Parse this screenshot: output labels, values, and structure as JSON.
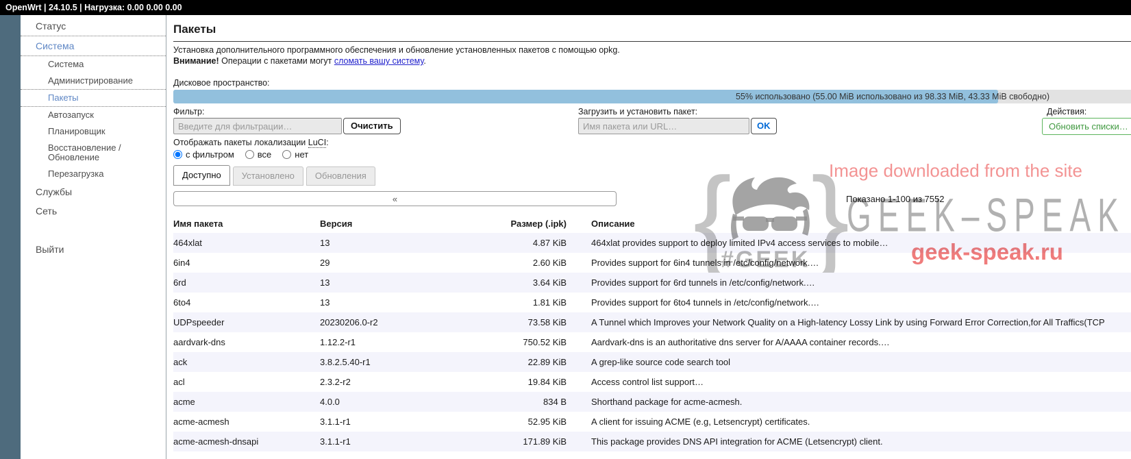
{
  "topbar": {
    "title": "OpenWrt | 24.10.5 | Нагрузка: 0.00 0.00 0.00"
  },
  "sidebar": {
    "items": [
      {
        "key": "status",
        "label": "Статус",
        "level": "top"
      },
      {
        "key": "system",
        "label": "Система",
        "level": "top",
        "active": true,
        "dot_top": true,
        "dot_bottom": true
      },
      {
        "key": "system-sub",
        "label": "Система",
        "level": "sub"
      },
      {
        "key": "administration",
        "label": "Администрирование",
        "level": "sub"
      },
      {
        "key": "packages",
        "label": "Пакеты",
        "level": "sub",
        "active": true,
        "dot_top": true,
        "dot_bottom": true
      },
      {
        "key": "startup",
        "label": "Автозапуск",
        "level": "sub"
      },
      {
        "key": "scheduler",
        "label": "Планировщик",
        "level": "sub"
      },
      {
        "key": "backup-restore",
        "label": "Восстановление / Обновление",
        "level": "sub"
      },
      {
        "key": "reboot",
        "label": "Перезагрузка",
        "level": "sub"
      },
      {
        "key": "services",
        "label": "Службы",
        "level": "top"
      },
      {
        "key": "network",
        "label": "Сеть",
        "level": "top"
      },
      {
        "key": "logout",
        "label": "Выйти",
        "level": "top",
        "logout": true
      }
    ]
  },
  "page": {
    "title": "Пакеты",
    "intro": "Установка дополнительного программного обеспечения и обновление установленных пакетов с помощью opkg.",
    "warning_bold": "Внимание!",
    "warning_mid": " Операции с пакетами могут ",
    "warning_link": "сломать вашу систему",
    "warning_suffix": "."
  },
  "disk": {
    "label": "Дисковое пространство:",
    "percent_used": 55,
    "usage_text": "55% использовано (55.00 MiB использовано из 98.33 MiB, 43.33 MiB свободно)"
  },
  "filter": {
    "label": "Фильтр:",
    "placeholder": "Введите для фильтрации…",
    "value": "",
    "clear_label": "Очистить"
  },
  "upload": {
    "label": "Загрузить и установить пакет:",
    "placeholder": "Имя пакета или URL…",
    "value": "",
    "ok_label": "OK"
  },
  "actions": {
    "label": "Действия:",
    "update_label": "Обновить списки…"
  },
  "display_options": {
    "label_prefix": "Отображать пакеты локализации ",
    "abbr": "LuCI",
    "label_suffix": ":",
    "options": [
      {
        "label": "с фильтром",
        "checked": true
      },
      {
        "label": "все",
        "checked": false
      },
      {
        "label": "нет",
        "checked": false
      }
    ]
  },
  "tabs": [
    {
      "key": "available",
      "label": "Доступно",
      "active": true
    },
    {
      "key": "installed",
      "label": "Установлено",
      "active": false
    },
    {
      "key": "updates",
      "label": "Обновления",
      "active": false
    }
  ],
  "pagination": {
    "prev_label": "«",
    "info": "Показано 1-100 из 7552"
  },
  "table": {
    "columns": [
      "Имя пакета",
      "Версия",
      "Размер (.ipk)",
      "Описание"
    ],
    "rows": [
      {
        "name": "464xlat",
        "version": "13",
        "size": "4.87 KiB",
        "desc": "464xlat provides support to deploy limited IPv4 access services to mobile…"
      },
      {
        "name": "6in4",
        "version": "29",
        "size": "2.60 KiB",
        "desc": "Provides support for 6in4 tunnels in /etc/config/network.…"
      },
      {
        "name": "6rd",
        "version": "13",
        "size": "3.64 KiB",
        "desc": "Provides support for 6rd tunnels in /etc/config/network.…"
      },
      {
        "name": "6to4",
        "version": "13",
        "size": "1.81 KiB",
        "desc": "Provides support for 6to4 tunnels in /etc/config/network.…"
      },
      {
        "name": "UDPspeeder",
        "version": "20230206.0-r2",
        "size": "73.58 KiB",
        "desc": "A Tunnel which Improves your Network Quality on a High-latency Lossy Link by using Forward Error Correction,for All Traffics(TCP"
      },
      {
        "name": "aardvark-dns",
        "version": "1.12.2-r1",
        "size": "750.52 KiB",
        "desc": "Aardvark-dns is an authoritative dns server for A/AAAA container records.…"
      },
      {
        "name": "ack",
        "version": "3.8.2.5.40-r1",
        "size": "22.89 KiB",
        "desc": "A grep-like source code search tool"
      },
      {
        "name": "acl",
        "version": "2.3.2-r2",
        "size": "19.84 KiB",
        "desc": "Access control list support…"
      },
      {
        "name": "acme",
        "version": "4.0.0",
        "size": "834 B",
        "desc": "Shorthand package for acme-acmesh."
      },
      {
        "name": "acme-acmesh",
        "version": "3.1.1-r1",
        "size": "52.95 KiB",
        "desc": "A client for issuing ACME (e.g, Letsencrypt) certificates."
      },
      {
        "name": "acme-acmesh-dnsapi",
        "version": "3.1.1-r1",
        "size": "171.89 KiB",
        "desc": "This package provides DNS API integration for ACME (Letsencrypt) client."
      }
    ]
  },
  "watermark": {
    "line1": "Image downloaded from the site",
    "brand": "GEEK–SPEAK",
    "site": "geek-speak.ru",
    "hashtag": "#GEEK"
  }
}
